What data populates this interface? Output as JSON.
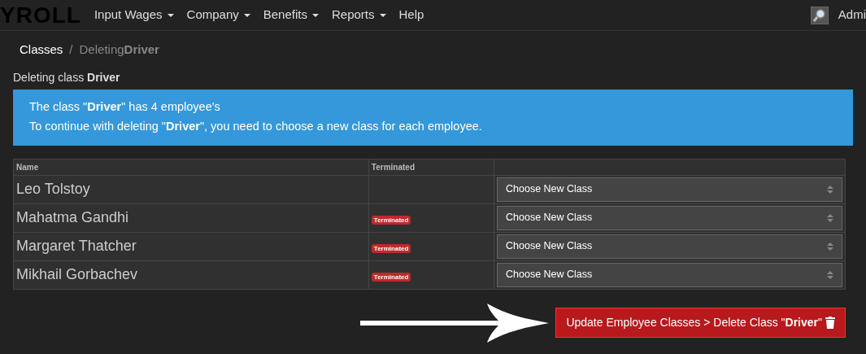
{
  "navbar": {
    "brand": "YROLL",
    "menus": [
      {
        "label": "Input Wages",
        "dropdown": true
      },
      {
        "label": "Company",
        "dropdown": true
      },
      {
        "label": "Benefits",
        "dropdown": true
      },
      {
        "label": "Reports",
        "dropdown": true
      },
      {
        "label": "Help",
        "dropdown": false
      }
    ],
    "user": "Admi"
  },
  "breadcrumb_separator": "/",
  "breadcrumb": [
    {
      "label": "Classes",
      "selected": false
    },
    {
      "label": "Deleting**Driver**",
      "selected": true
    }
  ],
  "heading": "Deleting class **Driver**",
  "alert": [
    "The class \"**Driver**\" has 4 employee's",
    "To continue with deleting \"**Driver**\", you need to choose a new class for each employee."
  ],
  "table": {
    "columns": [
      "Name",
      "Terminated"
    ],
    "rows": [
      {
        "name": "Leo Tolstoy",
        "select": "Choose New Class"
      },
      {
        "name": "Mahatma Gandhi",
        "badge": "Terminated",
        "select": "Choose New Class"
      },
      {
        "name": "Margaret Thatcher",
        "badge": "Terminated",
        "select": "Choose New Class"
      },
      {
        "name": "Mikhail Gorbachev",
        "badge": "Terminated",
        "select": "Choose New Class"
      }
    ]
  },
  "submit_button": "Update Employee Classes > Delete Class \"**Driver**\""
}
